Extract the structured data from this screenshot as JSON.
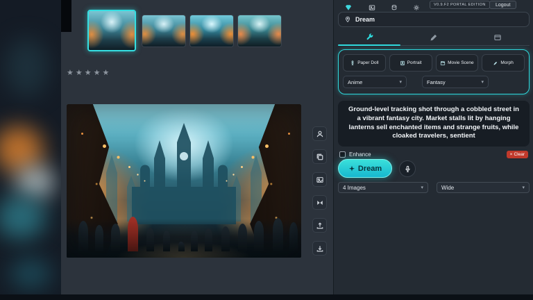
{
  "topbar": {
    "version_label": "v0.9.f2 PORTAL EDITION",
    "logout_label": "Logout"
  },
  "rating": {
    "stars": "★★★★★"
  },
  "panel": {
    "title": "Dream",
    "modes": [
      "Paper Doll",
      "Portrait",
      "Movie Scene",
      "Morph"
    ],
    "styles": {
      "primary": "Anime",
      "secondary": "Fantasy"
    },
    "prompt": "Ground-level tracking shot through a cobbled street in a vibrant fantasy city. Market stalls lit by hanging lanterns sell enchanted items and strange fruits, while cloaked travelers, sentient",
    "enhance_label": "Enhance",
    "clear_label": "Clear",
    "dream_label": "Dream",
    "images_count": "4 Images",
    "aspect": "Wide"
  },
  "icons": {
    "chevron": "▾",
    "close": "×"
  },
  "colors": {
    "accent": "#2fd9dc",
    "danger": "#c0392b"
  }
}
